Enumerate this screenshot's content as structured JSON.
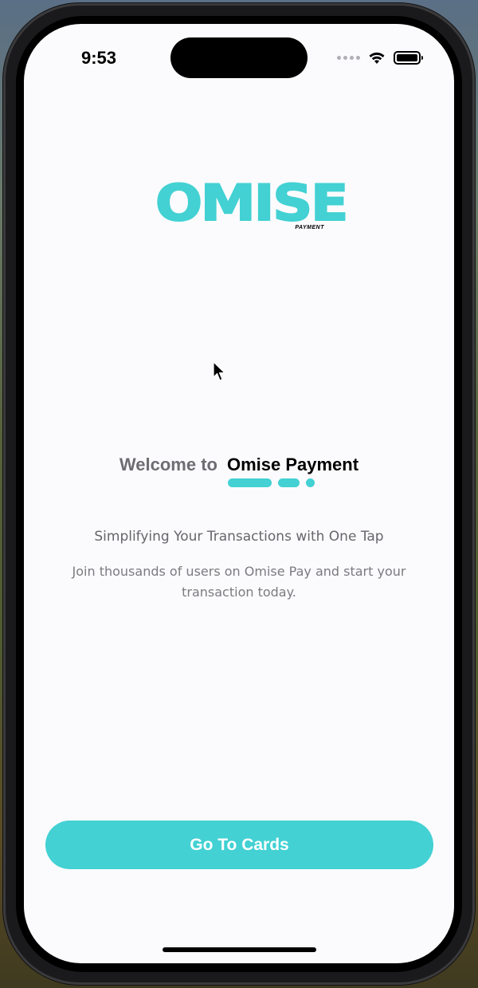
{
  "status_bar": {
    "time": "9:53",
    "icons": [
      "signal-dots-icon",
      "wifi-icon",
      "battery-icon"
    ]
  },
  "logo": {
    "name": "OMISE",
    "sub": "PAYMENT",
    "color": "#43d1d3"
  },
  "welcome": {
    "prefix": "Welcome to",
    "brand": "Omise Payment"
  },
  "tagline": "Simplifying Your Transactions with One Tap",
  "description": "Join thousands of users on Omise Pay and start your transaction today.",
  "cta": {
    "label": "Go To Cards"
  },
  "colors": {
    "accent": "#43d1d3",
    "background": "#fbfbfd",
    "text_primary": "#000000",
    "text_secondary": "#6d6d72"
  }
}
